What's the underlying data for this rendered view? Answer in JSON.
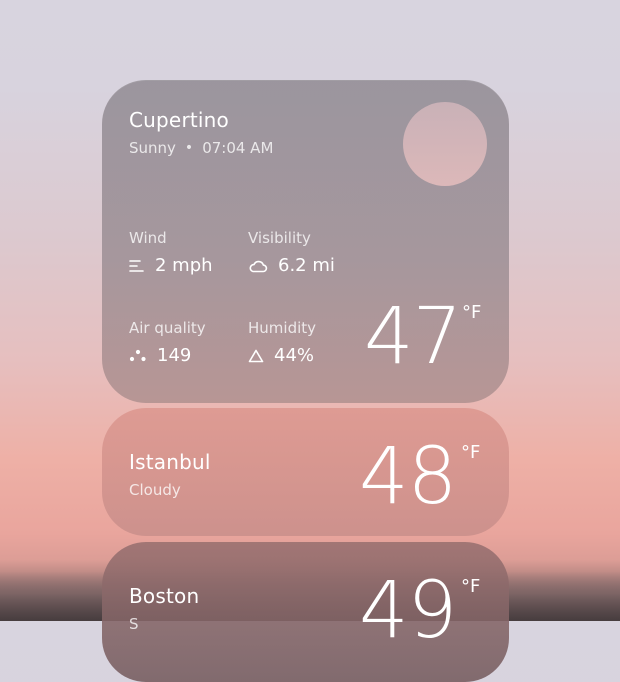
{
  "cities": [
    {
      "name": "Cupertino",
      "condition": "Sunny",
      "time": "07:04 AM",
      "temperature": "47",
      "unit": "°F",
      "metrics": {
        "wind": {
          "label": "Wind",
          "value": "2 mph",
          "icon": "wind-icon"
        },
        "visibility": {
          "label": "Visibility",
          "value": "6.2 mi",
          "icon": "cloud-icon"
        },
        "air_quality": {
          "label": "Air quality",
          "value": "149",
          "icon": "air-quality-icon"
        },
        "humidity": {
          "label": "Humidity",
          "value": "44%",
          "icon": "humidity-icon"
        }
      }
    },
    {
      "name": "Istanbul",
      "condition": "Cloudy",
      "temperature": "48",
      "unit": "°F"
    },
    {
      "name": "Boston",
      "condition": "S",
      "temperature": "49",
      "unit": "°F"
    }
  ],
  "colors": {
    "sun_top": "#c9b1b7",
    "sun_bottom": "#dcb8b9",
    "text": "#ffffff"
  }
}
